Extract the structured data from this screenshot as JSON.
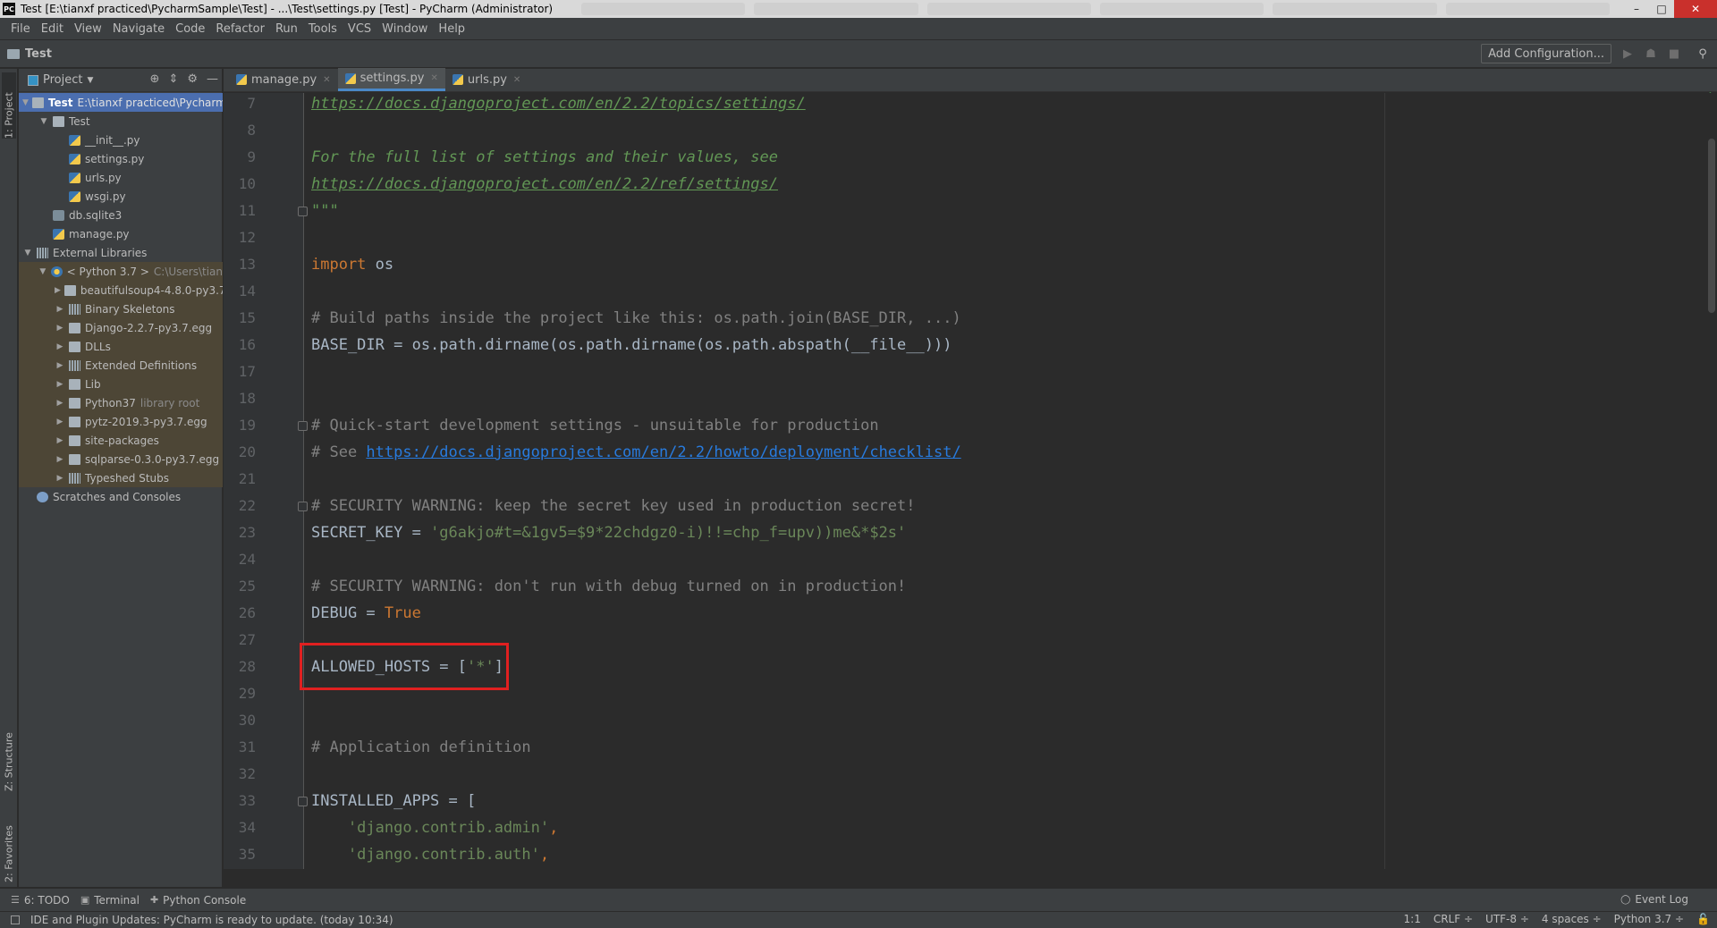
{
  "window": {
    "title": "Test [E:\\tianxf practiced\\PycharmSample\\Test] - ...\\Test\\settings.py [Test] - PyCharm (Administrator)",
    "app_icon": "PC",
    "minimize": "–",
    "maximize": "□",
    "close": "✕"
  },
  "menu": [
    "File",
    "Edit",
    "View",
    "Navigate",
    "Code",
    "Refactor",
    "Run",
    "Tools",
    "VCS",
    "Window",
    "Help"
  ],
  "navbar": {
    "breadcrumb": "Test",
    "add_config": "Add Configuration...",
    "run_icon": "▶",
    "debug_icon": "☗",
    "stop_icon": "■",
    "search_icon": "⚲"
  },
  "left_stripe": {
    "project": "1: Project",
    "structure": "Z: Structure",
    "favorites": "2: Favorites"
  },
  "project_panel": {
    "title": "Project",
    "dropdown": "▼",
    "locate_icon": "⊕",
    "collapse_icon": "⇕",
    "settings_icon": "⚙",
    "hide_icon": "—",
    "tree": [
      {
        "arrow": "▼",
        "icon": "folder",
        "label": "Test",
        "hint": "E:\\tianxf practiced\\Pycharm",
        "indent": 0
      },
      {
        "arrow": "▼",
        "icon": "folder",
        "label": "Test",
        "hint": "",
        "indent": 1
      },
      {
        "arrow": "",
        "icon": "py",
        "label": "__init__.py",
        "hint": "",
        "indent": 2
      },
      {
        "arrow": "",
        "icon": "py",
        "label": "settings.py",
        "hint": "",
        "indent": 2
      },
      {
        "arrow": "",
        "icon": "py",
        "label": "urls.py",
        "hint": "",
        "indent": 2
      },
      {
        "arrow": "",
        "icon": "py",
        "label": "wsgi.py",
        "hint": "",
        "indent": 2
      },
      {
        "arrow": "",
        "icon": "db",
        "label": "db.sqlite3",
        "hint": "",
        "indent": 1
      },
      {
        "arrow": "",
        "icon": "py",
        "label": "manage.py",
        "hint": "",
        "indent": 1
      },
      {
        "arrow": "▼",
        "icon": "lib",
        "label": "External Libraries",
        "hint": "",
        "indent": 0
      },
      {
        "arrow": "▼",
        "icon": "python",
        "label": "< Python 3.7 >",
        "hint": "C:\\Users\\tian",
        "indent": 1
      },
      {
        "arrow": "▶",
        "icon": "folder",
        "label": "beautifulsoup4-4.8.0-py3.7",
        "hint": "",
        "indent": 2
      },
      {
        "arrow": "▶",
        "icon": "lib",
        "label": "Binary Skeletons",
        "hint": "",
        "indent": 2
      },
      {
        "arrow": "▶",
        "icon": "folder",
        "label": "Django-2.2.7-py3.7.egg",
        "hint": "",
        "indent": 2
      },
      {
        "arrow": "▶",
        "icon": "folder",
        "label": "DLLs",
        "hint": "",
        "indent": 2
      },
      {
        "arrow": "▶",
        "icon": "lib",
        "label": "Extended Definitions",
        "hint": "",
        "indent": 2
      },
      {
        "arrow": "▶",
        "icon": "folder",
        "label": "Lib",
        "hint": "",
        "indent": 2
      },
      {
        "arrow": "▶",
        "icon": "folder",
        "label": "Python37",
        "hint": "library root",
        "indent": 2
      },
      {
        "arrow": "▶",
        "icon": "folder",
        "label": "pytz-2019.3-py3.7.egg",
        "hint": "",
        "indent": 2
      },
      {
        "arrow": "▶",
        "icon": "folder",
        "label": "site-packages",
        "hint": "",
        "indent": 2
      },
      {
        "arrow": "▶",
        "icon": "folder",
        "label": "sqlparse-0.3.0-py3.7.egg",
        "hint": "",
        "indent": 2
      },
      {
        "arrow": "▶",
        "icon": "lib",
        "label": "Typeshed Stubs",
        "hint": "",
        "indent": 2
      },
      {
        "arrow": "",
        "icon": "scratch",
        "label": "Scratches and Consoles",
        "hint": "",
        "indent": 0
      }
    ]
  },
  "editor_tabs": [
    {
      "label": "manage.py",
      "active": false
    },
    {
      "label": "settings.py",
      "active": true
    },
    {
      "label": "urls.py",
      "active": false
    }
  ],
  "code": [
    {
      "n": "7",
      "tokens": [
        {
          "t": "https://docs.djangoproject.com/en/2.2/topics/settings/",
          "c": "doclink"
        }
      ]
    },
    {
      "n": "8",
      "tokens": []
    },
    {
      "n": "9",
      "tokens": [
        {
          "t": "For the full list of settings and their values, see",
          "c": "doc"
        }
      ]
    },
    {
      "n": "10",
      "tokens": [
        {
          "t": "https://docs.djangoproject.com/en/2.2/ref/settings/",
          "c": "doclink"
        }
      ]
    },
    {
      "n": "11",
      "tokens": [
        {
          "t": "\"\"\"",
          "c": "doc"
        }
      ]
    },
    {
      "n": "12",
      "tokens": []
    },
    {
      "n": "13",
      "tokens": [
        {
          "t": "import",
          "c": "kw"
        },
        {
          "t": " os",
          "c": ""
        }
      ]
    },
    {
      "n": "14",
      "tokens": []
    },
    {
      "n": "15",
      "tokens": [
        {
          "t": "# Build paths inside the project like this: os.path.join(BASE_DIR, ...)",
          "c": "cm"
        }
      ]
    },
    {
      "n": "16",
      "tokens": [
        {
          "t": "BASE_DIR = os.path.dirname(os.path.dirname(os.path.abspath(__file__)))",
          "c": ""
        }
      ]
    },
    {
      "n": "17",
      "tokens": []
    },
    {
      "n": "18",
      "tokens": []
    },
    {
      "n": "19",
      "tokens": [
        {
          "t": "# Quick-start development settings - unsuitable for production",
          "c": "cm"
        }
      ]
    },
    {
      "n": "20",
      "tokens": [
        {
          "t": "# See ",
          "c": "cm"
        },
        {
          "t": "https://docs.djangoproject.com/en/2.2/howto/deployment/checklist/",
          "c": "cmlink"
        }
      ]
    },
    {
      "n": "21",
      "tokens": []
    },
    {
      "n": "22",
      "tokens": [
        {
          "t": "# SECURITY WARNING: keep the secret key used in production secret!",
          "c": "cm"
        }
      ]
    },
    {
      "n": "23",
      "tokens": [
        {
          "t": "SECRET_KEY = ",
          "c": ""
        },
        {
          "t": "'g6akjo#t=&1gv5=$9*22chdgz0-i)!!=chp_f=upv))me&*$2s'",
          "c": "str"
        }
      ]
    },
    {
      "n": "24",
      "tokens": []
    },
    {
      "n": "25",
      "tokens": [
        {
          "t": "# SECURITY WARNING: don't run with debug turned on in production!",
          "c": "cm"
        }
      ]
    },
    {
      "n": "26",
      "tokens": [
        {
          "t": "DEBUG = ",
          "c": ""
        },
        {
          "t": "True",
          "c": "kw"
        }
      ]
    },
    {
      "n": "27",
      "tokens": []
    },
    {
      "n": "28",
      "tokens": [
        {
          "t": "ALLOWED_HOSTS = [",
          "c": ""
        },
        {
          "t": "'*'",
          "c": "str"
        },
        {
          "t": "]",
          "c": ""
        }
      ]
    },
    {
      "n": "29",
      "tokens": []
    },
    {
      "n": "30",
      "tokens": []
    },
    {
      "n": "31",
      "tokens": [
        {
          "t": "# Application definition",
          "c": "cm"
        }
      ]
    },
    {
      "n": "32",
      "tokens": []
    },
    {
      "n": "33",
      "tokens": [
        {
          "t": "INSTALLED_APPS = [",
          "c": ""
        }
      ]
    },
    {
      "n": "34",
      "tokens": [
        {
          "t": "    'django.contrib.admin'",
          "c": "str"
        },
        {
          "t": ",",
          "c": "kw"
        }
      ]
    },
    {
      "n": "35",
      "tokens": [
        {
          "t": "    'django.contrib.auth'",
          "c": "str"
        },
        {
          "t": ",",
          "c": "kw"
        }
      ]
    }
  ],
  "fold_lines": [
    "11",
    "19",
    "22",
    "33"
  ],
  "bottom_tools": [
    {
      "icon": "☰",
      "label": "6: TODO"
    },
    {
      "icon": "▣",
      "label": "Terminal"
    },
    {
      "icon": "✚",
      "label": "Python Console"
    }
  ],
  "event_log": {
    "icon": "◯",
    "label": "Event Log"
  },
  "status": {
    "message": "IDE and Plugin Updates: PyCharm is ready to update. (today 10:34)",
    "position": "1:1",
    "line_sep": "CRLF ÷",
    "encoding": "UTF-8 ÷",
    "indent": "4 spaces ÷",
    "interpreter": "Python 3.7 ÷"
  },
  "colors": {
    "editor_bg": "#2b2b2b",
    "panel_bg": "#3c3f41",
    "selection": "#4b6eaf",
    "highlight_box": "#e02020"
  }
}
